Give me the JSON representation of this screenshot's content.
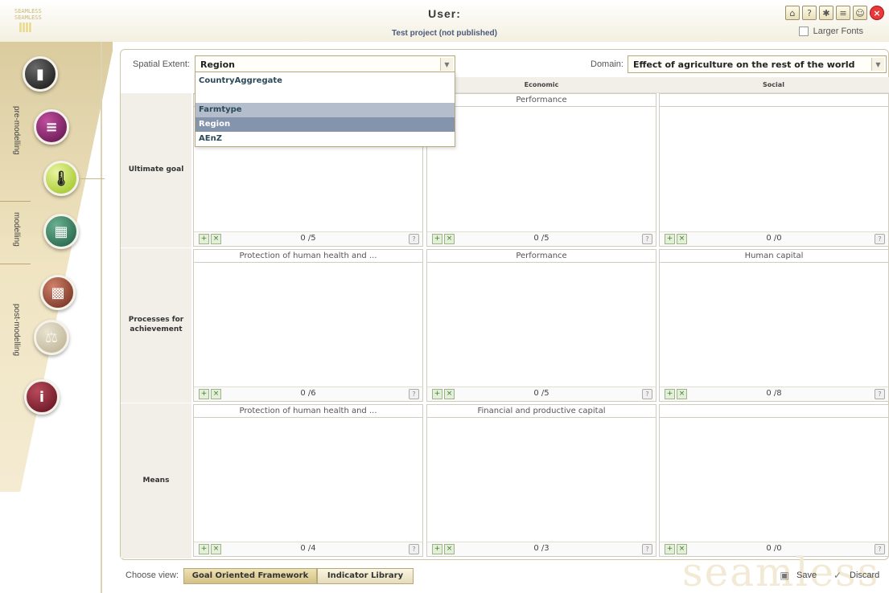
{
  "header": {
    "user_label": "User:",
    "project_label": "Test project (not published)",
    "larger_fonts_label": "Larger Fonts",
    "toolbar_icons": [
      "home-icon",
      "help-icon",
      "bug-icon",
      "list-icon",
      "users-icon",
      "close-icon"
    ]
  },
  "sidebar": {
    "sections": [
      "pre-modelling",
      "modelling",
      "post-modelling"
    ],
    "icons": [
      "clipboard-icon",
      "books-icon",
      "thermometer-icon",
      "calculator-icon",
      "chart-icon",
      "scales-icon",
      "info-icon"
    ]
  },
  "filters": {
    "spatial_label": "Spatial Extent:",
    "spatial_value": "Region",
    "domain_label": "Domain:",
    "domain_value": "Effect of agriculture on the rest of the world"
  },
  "dropdown": {
    "options": [
      "CountryAggregate",
      "",
      "Farmtype",
      "Region",
      "AEnZ"
    ]
  },
  "grid": {
    "columns": [
      "Economic",
      "Social"
    ],
    "rows": [
      {
        "label": "Ultimate goal",
        "cells": [
          {
            "title": "",
            "count": ""
          },
          {
            "title": "Performance",
            "count": "0 /5"
          },
          {
            "title": "",
            "count": "0 /0"
          }
        ]
      },
      {
        "label": "Processes for achievement",
        "cells": [
          {
            "title": "Protection of human health and ...",
            "count": "0 /6"
          },
          {
            "title": "Performance",
            "count": "0 /5"
          },
          {
            "title": "Human capital",
            "count": "0 /8"
          }
        ]
      },
      {
        "label": "Means",
        "cells": [
          {
            "title": "Protection of human health and ...",
            "count": "0 /4"
          },
          {
            "title": "Financial and productive capital",
            "count": "0 /3"
          },
          {
            "title": "",
            "count": "0 /0"
          }
        ]
      }
    ],
    "first_cell_count": "0 /5"
  },
  "footer": {
    "choose_view_label": "Choose view:",
    "view_goal": "Goal Oriented Framework",
    "view_library": "Indicator Library",
    "save_label": "Save",
    "discard_label": "Discard",
    "watermark": "seamless"
  }
}
